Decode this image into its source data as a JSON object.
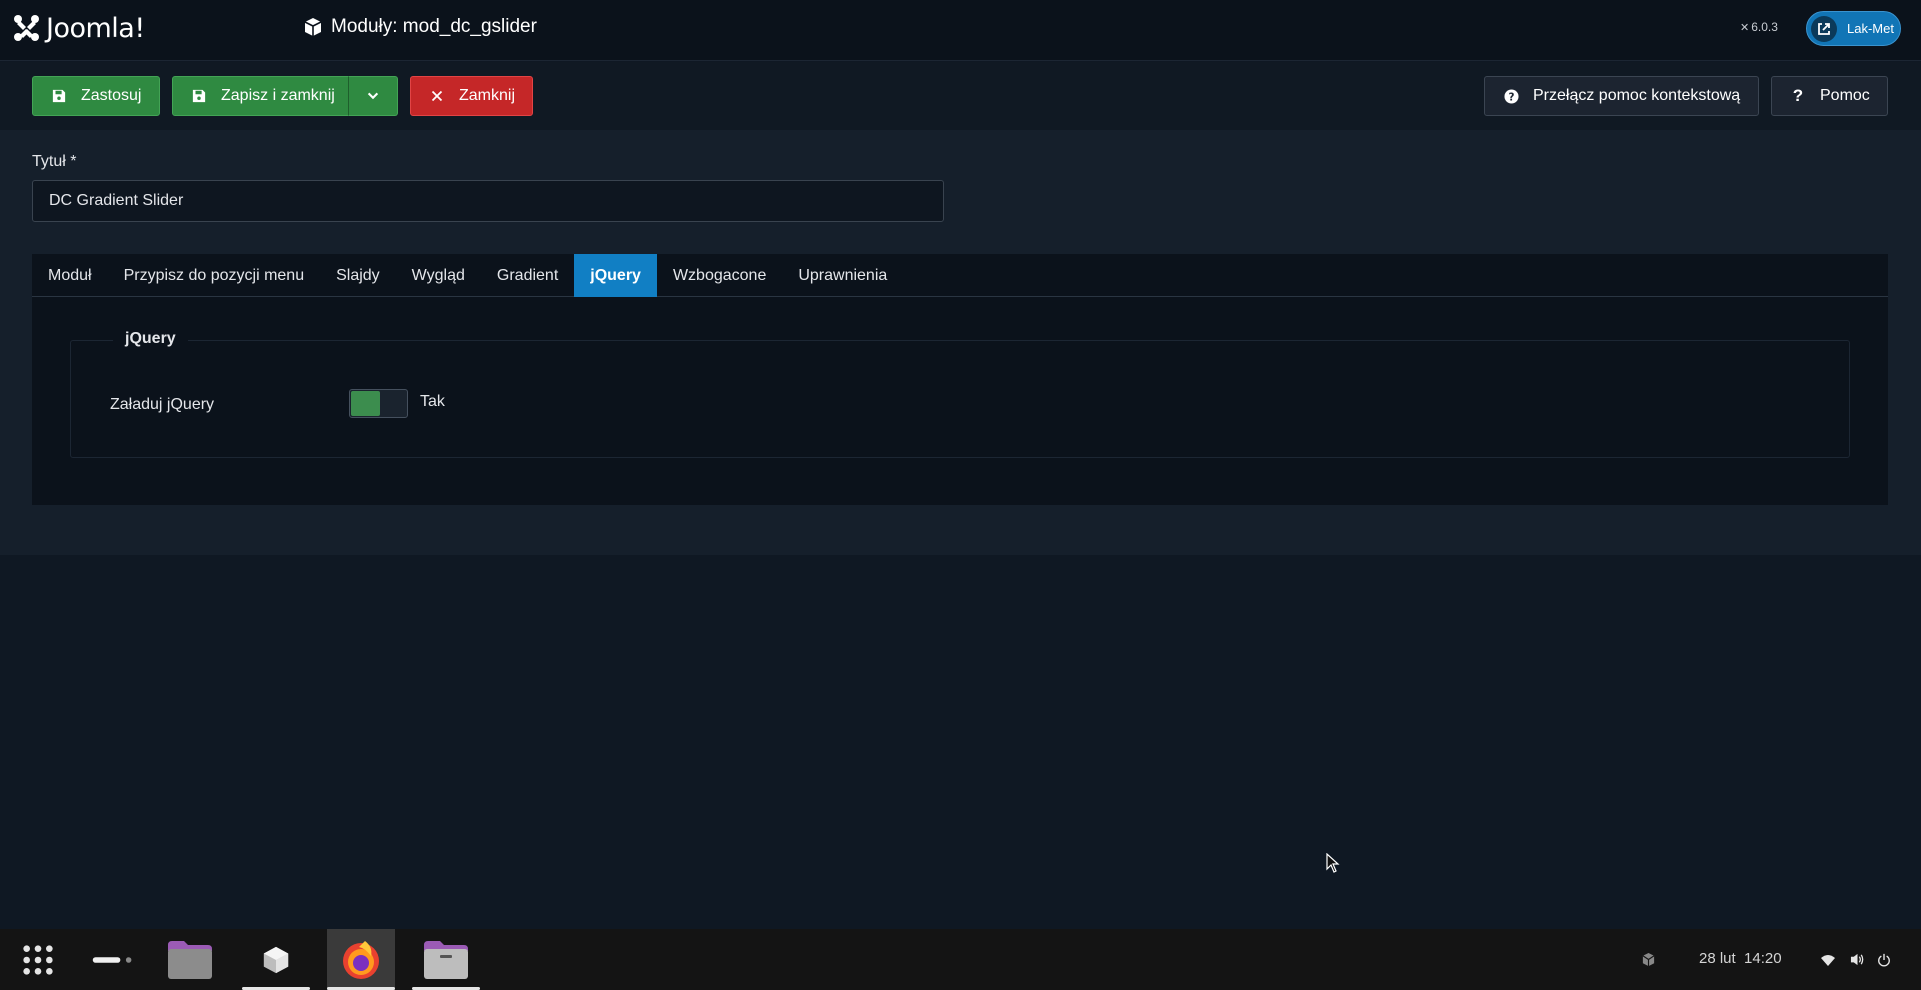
{
  "header": {
    "brand": "Joomla!",
    "page_title": "Moduły: mod_dc_gslider",
    "version": "6.0.3",
    "site_button": "Lak-Met"
  },
  "toolbar": {
    "apply": "Zastosuj",
    "save_close": "Zapisz i zamknij",
    "close": "Zamknij",
    "toggle_help": "Przełącz pomoc kontekstową",
    "help": "Pomoc"
  },
  "form": {
    "title_label": "Tytuł *",
    "title_value": "DC Gradient Slider"
  },
  "tabs": [
    {
      "label": "Moduł",
      "active": false
    },
    {
      "label": "Przypisz do pozycji menu",
      "active": false
    },
    {
      "label": "Slajdy",
      "active": false
    },
    {
      "label": "Wygląd",
      "active": false
    },
    {
      "label": "Gradient",
      "active": false
    },
    {
      "label": "jQuery",
      "active": true
    },
    {
      "label": "Wzbogacone",
      "active": false
    },
    {
      "label": "Uprawnienia",
      "active": false
    }
  ],
  "panel": {
    "legend": "jQuery",
    "field_label": "Załaduj jQuery",
    "switch_value": "Tak",
    "switch_on": true
  },
  "taskbar": {
    "date": "28 lut",
    "time": "14:20"
  },
  "colors": {
    "green": "#2f8a41",
    "red": "#c52728",
    "blue": "#117fc4"
  }
}
